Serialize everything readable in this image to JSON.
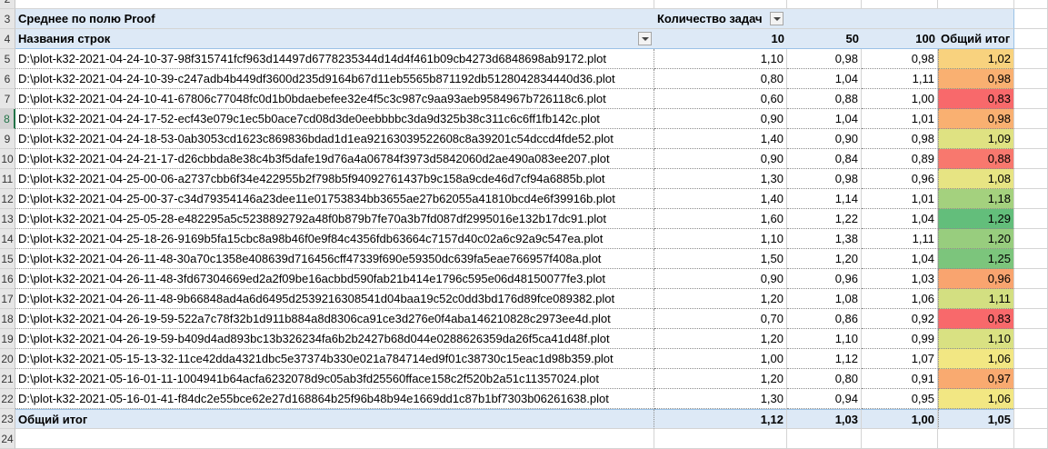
{
  "row_numbers": [
    "2",
    "3",
    "4",
    "5",
    "6",
    "7",
    "8",
    "9",
    "10",
    "11",
    "12",
    "13",
    "14",
    "15",
    "16",
    "17",
    "18",
    "19",
    "20",
    "21",
    "22",
    "23",
    "24"
  ],
  "pivot": {
    "title": "Среднее по полю Proof",
    "column_field_label": "Количество задач",
    "row_field_label": "Названия строк",
    "column_headers": [
      "10",
      "50",
      "100",
      "Общий итог"
    ],
    "rows": [
      {
        "label": "D:\\plot-k32-2021-04-24-10-37-98f315741fcf963d14497d6778235344d14d4f461b09cb4273d6848698ab9172.plot",
        "v10": "1,10",
        "v50": "0,98",
        "v100": "0,98",
        "total": "1,02",
        "color": "#f8d27e"
      },
      {
        "label": "D:\\plot-k32-2021-04-24-10-39-c247adb4b449df3600d235d9164b67d11eb5565b871192db5128042834440d36.plot",
        "v10": "0,80",
        "v50": "1,04",
        "v100": "1,11",
        "total": "0,98",
        "color": "#f9b071"
      },
      {
        "label": "D:\\plot-k32-2021-04-24-10-41-67806c77048fc0d1b0bdaebefee32e4f5c3c987c9aa93aeb9584967b726118c6.plot",
        "v10": "0,60",
        "v50": "0,88",
        "v100": "1,00",
        "total": "0,83",
        "color": "#f8696b"
      },
      {
        "label": "D:\\plot-k32-2021-04-24-17-52-ecf43e079c1ec5b0ace7cd08d3de0eebbbbc3da9d325b38c311c6c6ff1fb142c.plot",
        "v10": "0,90",
        "v50": "1,04",
        "v100": "1,01",
        "total": "0,98",
        "color": "#f9b071"
      },
      {
        "label": "D:\\plot-k32-2021-04-24-18-53-0ab3053cd1623c869836bdad1d1ea92163039522608c8a39201c54dccd4fde52.plot",
        "v10": "1,40",
        "v50": "0,90",
        "v100": "0,98",
        "total": "1,09",
        "color": "#dfe282"
      },
      {
        "label": "D:\\plot-k32-2021-04-24-21-17-d26cbbda8e38c4b3f5dafe19d76a4a06784f3973d5842060d2ae490a083ee207.plot",
        "v10": "0,90",
        "v50": "0,84",
        "v100": "0,89",
        "total": "0,88",
        "color": "#f8786e"
      },
      {
        "label": "D:\\plot-k32-2021-04-25-00-06-a2737cbb6f34e422955b2f798b5f94092761437b9c158a9cde46d7cf94a6885b.plot",
        "v10": "1,30",
        "v50": "0,98",
        "v100": "0,96",
        "total": "1,08",
        "color": "#e7e483"
      },
      {
        "label": "D:\\plot-k32-2021-04-25-00-37-c34d79354146a23dee11e01753834bb3655ae27b62055a41810bcd4e6f39916b.plot",
        "v10": "1,40",
        "v50": "1,14",
        "v100": "1,01",
        "total": "1,18",
        "color": "#a4d17e"
      },
      {
        "label": "D:\\plot-k32-2021-04-25-05-28-e482295a5c5238892792a48f0b879b7fe70a3b7fd087df2995016e132b17dc91.plot",
        "v10": "1,60",
        "v50": "1,22",
        "v100": "1,04",
        "total": "1,29",
        "color": "#63be7b"
      },
      {
        "label": "D:\\plot-k32-2021-04-25-18-26-9169b5fa15cbc8a98b46f0e9f84c4356fdb63664c7157d40c02a6c92a9c547ea.plot",
        "v10": "1,10",
        "v50": "1,38",
        "v100": "1,11",
        "total": "1,20",
        "color": "#98cd7e"
      },
      {
        "label": "D:\\plot-k32-2021-04-26-11-48-30a70c1358e408639d716456cff47339f690e59350dc639fa5eae766957f408a.plot",
        "v10": "1,50",
        "v50": "1,20",
        "v100": "1,04",
        "total": "1,25",
        "color": "#7cc57c"
      },
      {
        "label": "D:\\plot-k32-2021-04-26-11-48-3fd67304669ed2a2f09be16acbbd590fab21b414e1796c595e06d48150077fe3.plot",
        "v10": "0,90",
        "v50": "0,96",
        "v100": "1,03",
        "total": "0,96",
        "color": "#f9a46f"
      },
      {
        "label": "D:\\plot-k32-2021-04-26-11-48-9b66848ad4a6d6495d2539216308541d04baa19c52c0dd3bd176d89fce089382.plot",
        "v10": "1,20",
        "v50": "1,08",
        "v100": "1,06",
        "total": "1,11",
        "color": "#d3df81"
      },
      {
        "label": "D:\\plot-k32-2021-04-26-19-59-522a7c78f32b1d911b884a8d8306ca91ce3d276e0f4aba146210828c2973ee4d.plot",
        "v10": "0,70",
        "v50": "0,86",
        "v100": "0,92",
        "total": "0,83",
        "color": "#f8696b"
      },
      {
        "label": "D:\\plot-k32-2021-04-26-19-59-b409d4ad893bc13b326234fa6b2b2427b68d044e0288626359da26f5ca41d48f.plot",
        "v10": "1,20",
        "v50": "1,10",
        "v100": "0,99",
        "total": "1,10",
        "color": "#d9e182"
      },
      {
        "label": "D:\\plot-k32-2021-05-15-13-32-11ce42dda4321dbc5e37374b330e021a784714ed9f01c38730c15eac1d98b359.plot",
        "v10": "1,00",
        "v50": "1,12",
        "v100": "1,07",
        "total": "1,06",
        "color": "#f2e783"
      },
      {
        "label": "D:\\plot-k32-2021-05-16-01-11-1004941b64acfa6232078d9c05ab3fd25560fface158c2f520b2a51c11357024.plot",
        "v10": "1,20",
        "v50": "0,80",
        "v100": "0,91",
        "total": "0,97",
        "color": "#f9aa70"
      },
      {
        "label": "D:\\plot-k32-2021-05-16-01-41-f84dc2e55bce62e27d168864b25f96b48b94e1669dd1c87b1bf7303b06261638.plot",
        "v10": "1,30",
        "v50": "0,94",
        "v100": "0,95",
        "total": "1,06",
        "color": "#f2e783"
      }
    ],
    "grand_total": {
      "label": "Общий итог",
      "v10": "1,12",
      "v50": "1,03",
      "v100": "1,00",
      "total": "1,05"
    }
  }
}
